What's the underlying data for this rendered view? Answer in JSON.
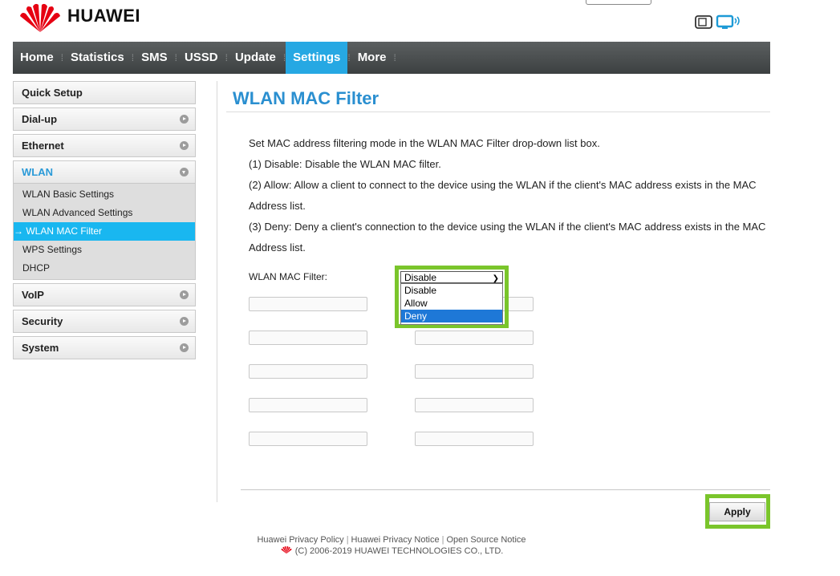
{
  "brand": {
    "name": "HUAWEI",
    "logo_color": "#e60012"
  },
  "nav": {
    "items": [
      {
        "label": "Home",
        "active": false
      },
      {
        "label": "Statistics",
        "active": false
      },
      {
        "label": "SMS",
        "active": false
      },
      {
        "label": "USSD",
        "active": false
      },
      {
        "label": "Update",
        "active": false
      },
      {
        "label": "Settings",
        "active": true
      },
      {
        "label": "More",
        "active": false
      }
    ],
    "separator": "⁞"
  },
  "sidebar": {
    "items": [
      {
        "label": "Quick Setup"
      },
      {
        "label": "Dial-up"
      },
      {
        "label": "Ethernet"
      },
      {
        "label": "WLAN"
      },
      {
        "label": "VoIP"
      },
      {
        "label": "Security"
      },
      {
        "label": "System"
      }
    ],
    "wlan_sub": [
      {
        "label": "WLAN Basic Settings"
      },
      {
        "label": "WLAN Advanced Settings"
      },
      {
        "label": "→ WLAN MAC Filter"
      },
      {
        "label": "WPS Settings"
      },
      {
        "label": "DHCP"
      }
    ]
  },
  "main": {
    "title": "WLAN MAC Filter",
    "description": [
      "Set MAC address filtering mode in the WLAN MAC Filter drop-down list box.",
      "(1) Disable: Disable the WLAN MAC filter.",
      "(2) Allow: Allow a client to connect to the device using the WLAN if the client's MAC address exists in the MAC Address list.",
      "(3) Deny: Deny a client's connection to the device using the WLAN if the client's MAC address exists in the MAC Address list."
    ],
    "filter_label": "WLAN MAC Filter:",
    "filter_value": "Disable",
    "filter_options": [
      "Disable",
      "Allow",
      "Deny"
    ],
    "highlighted_option": "Deny",
    "apply_label": "Apply"
  },
  "footer": {
    "links": [
      "Huawei Privacy Policy",
      "Huawei Privacy Notice",
      "Open Source Notice"
    ],
    "copyright": "(C) 2006-2019 HUAWEI TECHNOLOGIES CO., LTD."
  },
  "colors": {
    "accent": "#26a8e3",
    "highlight": "#7ac52b",
    "active_sub": "#19b7f0"
  }
}
